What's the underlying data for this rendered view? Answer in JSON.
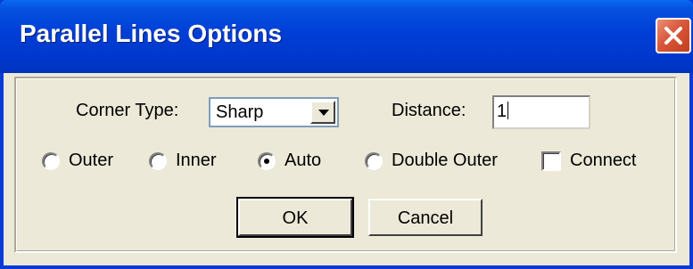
{
  "window": {
    "title": "Parallel Lines Options",
    "close_icon": "close-icon"
  },
  "corner_type": {
    "label": "Corner Type:",
    "selected": "Sharp"
  },
  "distance": {
    "label": "Distance:",
    "value": "1"
  },
  "options": {
    "outer": {
      "label": "Outer",
      "checked": false
    },
    "inner": {
      "label": "Inner",
      "checked": false
    },
    "auto": {
      "label": "Auto",
      "checked": true
    },
    "double_outer": {
      "label": "Double Outer",
      "checked": false
    },
    "connect": {
      "label": "Connect",
      "checked": false
    }
  },
  "buttons": {
    "ok": "OK",
    "cancel": "Cancel"
  }
}
